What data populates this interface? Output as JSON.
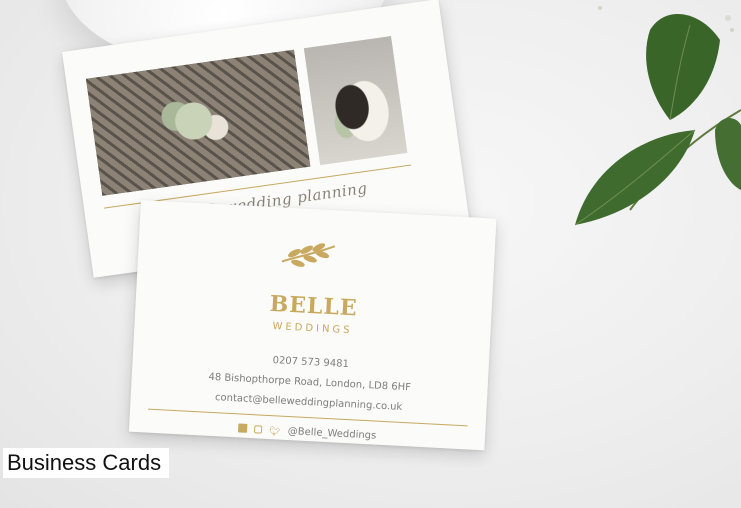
{
  "scene": {
    "back_card": {
      "tagline": "event & wedding planning",
      "photos": [
        "bouquet-photo",
        "couple-photo"
      ]
    },
    "front_card": {
      "brand": "BELLE",
      "subbrand": "WEDDINGS",
      "phone": "0207 573 9481",
      "address": "48 Bishopthorpe Road, London, LD8 6HF",
      "email": "contact@belleweddingplanning.co.uk",
      "social_handle": "@Belle_Weddings",
      "icons": [
        "facebook-icon",
        "instagram-icon",
        "twitter-icon",
        "laurel-logo-icon"
      ]
    },
    "colors": {
      "gold": "#c9a95f",
      "leaf": "#3f6b2e"
    }
  },
  "caption": "Business Cards"
}
